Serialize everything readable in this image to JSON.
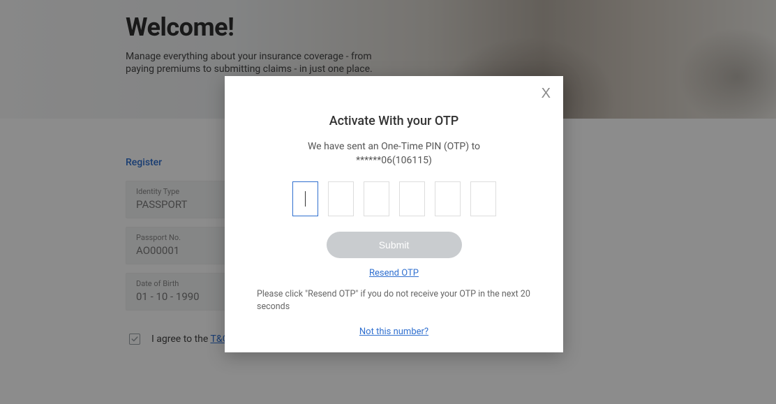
{
  "hero": {
    "title": "Welcome!",
    "subtitle_l1": "Manage everything about your insurance coverage - from",
    "subtitle_l2": "paying premiums to submitting claims - in just one place."
  },
  "register": {
    "heading": "Register",
    "fields": {
      "identity_type": {
        "label": "Identity Type",
        "value": "PASSPORT"
      },
      "passport_no": {
        "label": "Passport No.",
        "value": "AO00001"
      },
      "dob": {
        "label": "Date of Birth",
        "value": "01 - 10 - 1990"
      }
    },
    "agree_prefix": "I agree to the ",
    "tc_link": "T&C"
  },
  "modal": {
    "title": "Activate With your OTP",
    "sent_line": "We have sent an One-Time PIN (OTP) to",
    "masked_target": "******06(106115)",
    "submit": "Submit",
    "resend": "Resend OTP",
    "help": "Please click \"Resend OTP\" if you do not receive your OTP in the next 20 seconds",
    "not_this": "Not this number?",
    "close_glyph": "X"
  }
}
